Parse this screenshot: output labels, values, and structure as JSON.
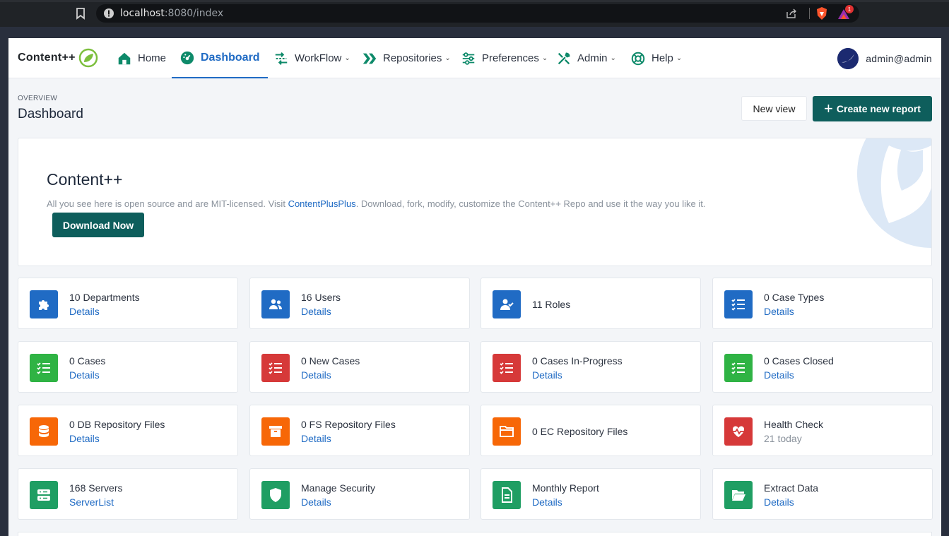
{
  "browser": {
    "url_host": "localhost",
    "url_rest": ":8080/index",
    "notification_count": "1"
  },
  "nav": {
    "brand": "Content++",
    "items": [
      {
        "label": "Home",
        "icon": "home-icon"
      },
      {
        "label": "Dashboard",
        "icon": "dashboard-icon"
      },
      {
        "label": "WorkFlow",
        "icon": "workflow-icon"
      },
      {
        "label": "Repositories",
        "icon": "repositories-icon"
      },
      {
        "label": "Preferences",
        "icon": "preferences-icon"
      },
      {
        "label": "Admin",
        "icon": "admin-icon"
      },
      {
        "label": "Help",
        "icon": "help-icon"
      }
    ],
    "user": "admin@admin"
  },
  "header": {
    "pretitle": "Overview",
    "title": "Dashboard",
    "new_view": "New view",
    "create_report": "Create new report"
  },
  "hero": {
    "title": "Content++",
    "text_before": "All you see here is open source and are MIT-licensed. Visit ",
    "link": "ContentPlusPlus",
    "text_after": ". Download, fork, modify, customize the Content++ Repo and use it the way you like it.",
    "button": "Download Now"
  },
  "cards": [
    {
      "title": "10 Departments",
      "link": "Details",
      "icon": "puzzle-icon",
      "color": "#206bc4"
    },
    {
      "title": "16 Users",
      "link": "Details",
      "icon": "users-icon",
      "color": "#206bc4"
    },
    {
      "title": "11 Roles",
      "link": "",
      "icon": "user-check-icon",
      "color": "#206bc4"
    },
    {
      "title": "0 Case Types",
      "link": "Details",
      "icon": "list-check-icon",
      "color": "#206bc4"
    },
    {
      "title": "0 Cases",
      "link": "Details",
      "icon": "list-check-icon",
      "color": "#2fb344"
    },
    {
      "title": "0 New Cases",
      "link": "Details",
      "icon": "list-check-icon",
      "color": "#d63939"
    },
    {
      "title": "0 Cases In-Progress",
      "link": "Details",
      "icon": "list-check-icon",
      "color": "#d63939"
    },
    {
      "title": "0 Cases Closed",
      "link": "Details",
      "icon": "list-check-icon",
      "color": "#2fb344"
    },
    {
      "title": "0 DB Repository Files",
      "link": "Details",
      "icon": "database-icon",
      "color": "#f76707"
    },
    {
      "title": "0 FS Repository Files",
      "link": "Details",
      "icon": "archive-icon",
      "color": "#f76707"
    },
    {
      "title": "0 EC Repository Files",
      "link": "",
      "icon": "folder-icon",
      "color": "#f76707"
    },
    {
      "title": "Health Check",
      "link": "21 today",
      "icon": "heart-rate-icon",
      "color": "#d63939"
    },
    {
      "title": "168 Servers",
      "link": "ServerList",
      "icon": "server-icon",
      "color": "#1f9e63"
    },
    {
      "title": "Manage Security",
      "link": "Details",
      "icon": "shield-icon",
      "color": "#1f9e63"
    },
    {
      "title": "Monthly Report",
      "link": "Details",
      "icon": "report-icon",
      "color": "#1f9e63"
    },
    {
      "title": "Extract Data",
      "link": "Details",
      "icon": "folder-open-icon",
      "color": "#1f9e63"
    }
  ]
}
